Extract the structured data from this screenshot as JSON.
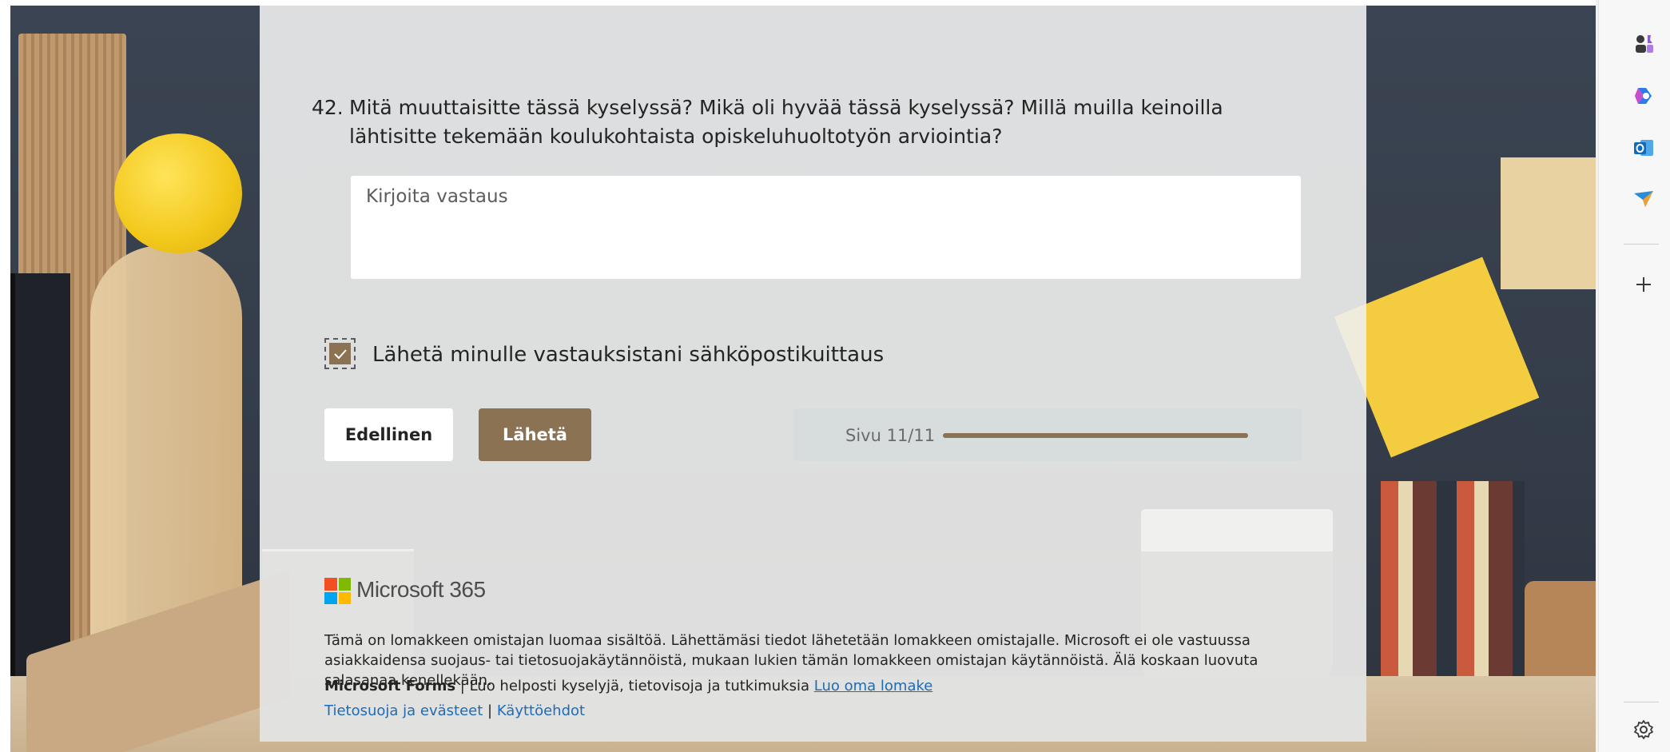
{
  "question": {
    "number": "42.",
    "text": "Mitä muuttaisitte tässä kyselyssä? Mikä oli hyvää tässä kyselyssä? Millä muilla keinoilla lähtisitte tekemään koulukohtaista opiskeluhuoltotyön arviointia?",
    "answer_placeholder": "Kirjoita vastaus",
    "answer_value": ""
  },
  "receipt": {
    "label": "Lähetä minulle vastauksistani sähköpostikuittaus",
    "checked": true
  },
  "buttons": {
    "previous": "Edellinen",
    "submit": "Lähetä"
  },
  "progress": {
    "label": "Sivu 11/11",
    "current_page": 11,
    "total_pages": 11,
    "fraction": 1.0
  },
  "footer": {
    "brand": "Microsoft 365",
    "disclaimer": "Tämä on lomakkeen omistajan luomaa sisältöä. Lähettämäsi tiedot lähetetään lomakkeen omistajalle. Microsoft ei ole vastuussa asiakkaidensa suojaus- tai tietosuojakäytännöistä, mukaan lukien tämän lomakkeen omistajan käytännöistä. Älä koskaan luovuta salasanaa kenellekään.",
    "forms_name": "Microsoft Forms",
    "forms_sep": " | ",
    "forms_tagline": "Luo helposti kyselyjä, tietovisoja ja tutkimuksia",
    "create_link": "Luo oma lomake",
    "privacy_link": "Tietosuoja ja evästeet",
    "legal_sep": " | ",
    "terms_link": "Käyttöehdot"
  },
  "sidebar": {
    "items": [
      {
        "icon": "chess-icon"
      },
      {
        "icon": "copilot-icon"
      },
      {
        "icon": "outlook-icon"
      },
      {
        "icon": "send-icon"
      },
      {
        "icon": "add-icon",
        "label": "+"
      },
      {
        "icon": "gear-icon"
      }
    ]
  },
  "colors": {
    "accent": "#8b7253",
    "link": "#1f6bb5",
    "text": "#242424"
  }
}
